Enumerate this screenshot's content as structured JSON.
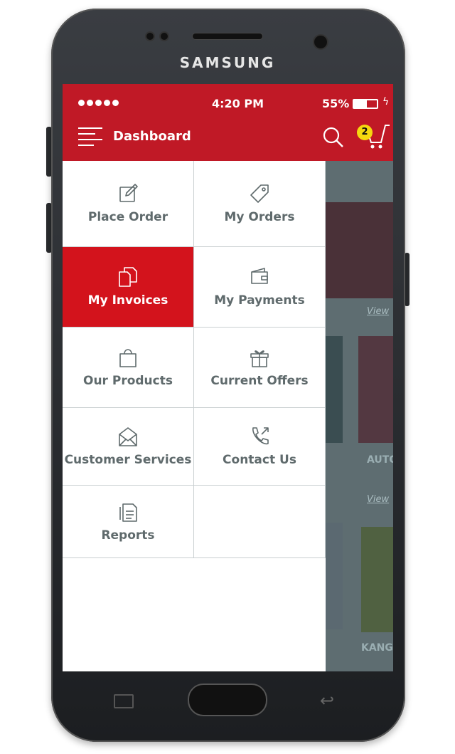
{
  "device": {
    "brand": "SAMSUNG"
  },
  "status_bar": {
    "time": "4:20 PM",
    "battery": "55%",
    "battery_level": 55
  },
  "header": {
    "title": "Dashboard",
    "cart_count": "2"
  },
  "menu": [
    {
      "label": "Place Order",
      "icon": "edit-icon"
    },
    {
      "label": "My Orders",
      "icon": "tag-icon"
    },
    {
      "label": "My Invoices",
      "icon": "documents-icon",
      "active": true
    },
    {
      "label": "My Payments",
      "icon": "wallet-icon"
    },
    {
      "label": "Our Products",
      "icon": "shopping-bag-icon"
    },
    {
      "label": "Current Offers",
      "icon": "gift-icon"
    },
    {
      "label": "Customer Services",
      "icon": "envelope-icon"
    },
    {
      "label": "Contact Us",
      "icon": "phone-icon"
    },
    {
      "label": "Reports",
      "icon": "report-icon"
    }
  ],
  "background": {
    "view_link_1": "View",
    "product_1": "AUTO",
    "view_link_2": "View",
    "product_2": "KANG"
  },
  "colors": {
    "primary": "#c01926",
    "active": "#d3131c",
    "badge": "#f5d80f"
  }
}
